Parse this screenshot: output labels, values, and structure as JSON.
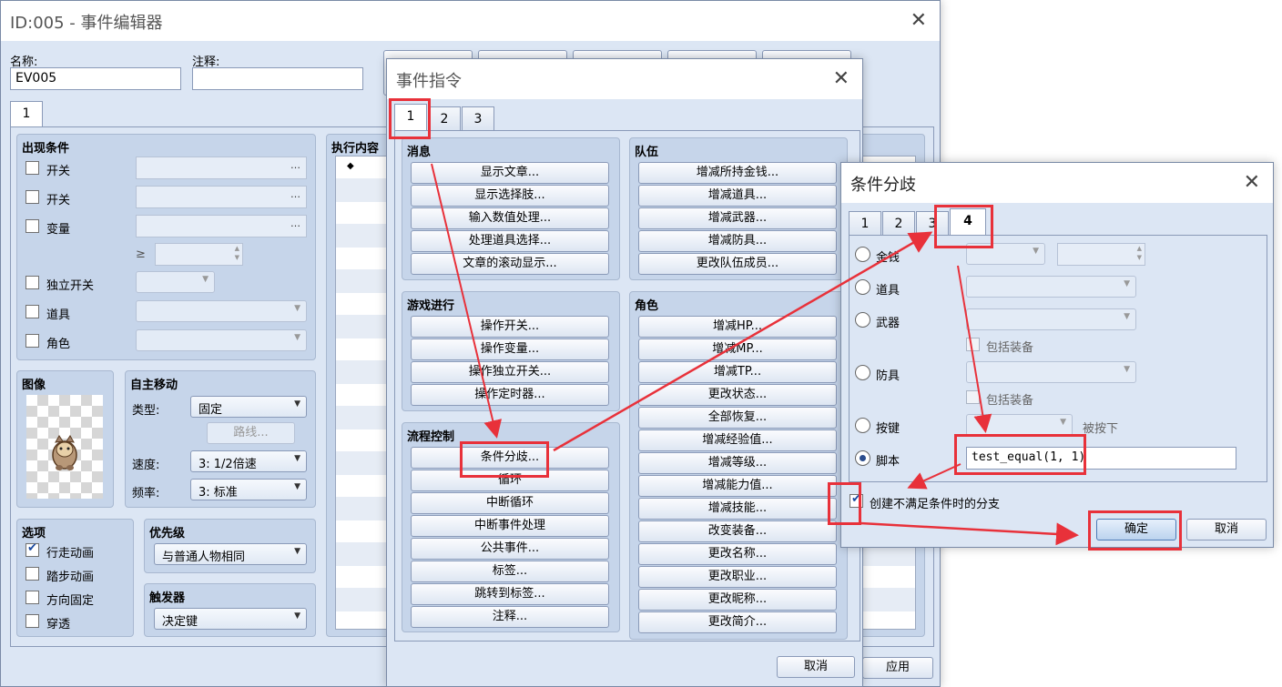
{
  "event_editor": {
    "title": "ID:005 - 事件编辑器",
    "name_label": "名称:",
    "name_value": "EV005",
    "note_label": "注释:",
    "note_value": "",
    "page_tab": "1",
    "conditions": {
      "title": "出现条件",
      "switch1": "开关",
      "switch2": "开关",
      "variable": "变量",
      "gte": "≥",
      "self_switch": "独立开关",
      "item": "道具",
      "actor": "角色",
      "ellipsis": "…"
    },
    "image": {
      "title": "图像"
    },
    "auto_move": {
      "title": "自主移动",
      "type_label": "类型:",
      "type_value": "固定",
      "route_button": "路线...",
      "speed_label": "速度:",
      "speed_value": "3: 1/2倍速",
      "freq_label": "频率:",
      "freq_value": "3: 标准"
    },
    "options": {
      "title": "选项",
      "walking": "行走动画",
      "stepping": "踏步动画",
      "direction_fix": "方向固定",
      "through": "穿透"
    },
    "priority": {
      "title": "优先级",
      "value": "与普通人物相同"
    },
    "trigger": {
      "title": "触发器",
      "value": "决定键"
    },
    "contents": {
      "title": "执行内容",
      "first_row": "◆"
    },
    "apply_button": "应用"
  },
  "command_dialog": {
    "title": "事件指令",
    "tabs": [
      "1",
      "2",
      "3"
    ],
    "message": {
      "title": "消息",
      "items": [
        "显示文章...",
        "显示选择肢...",
        "输入数值处理...",
        "处理道具选择...",
        "文章的滚动显示..."
      ]
    },
    "game_progress": {
      "title": "游戏进行",
      "items": [
        "操作开关...",
        "操作变量...",
        "操作独立开关...",
        "操作定时器..."
      ]
    },
    "flow_control": {
      "title": "流程控制",
      "items": [
        "条件分歧...",
        "循环",
        "中断循环",
        "中断事件处理",
        "公共事件...",
        "标签...",
        "跳转到标签...",
        "注释..."
      ]
    },
    "party": {
      "title": "队伍",
      "items": [
        "增减所持金钱...",
        "增减道具...",
        "增减武器...",
        "增减防具...",
        "更改队伍成员..."
      ]
    },
    "actor": {
      "title": "角色",
      "items": [
        "增减HP...",
        "增减MP...",
        "增减TP...",
        "更改状态...",
        "全部恢复...",
        "增减经验值...",
        "增减等级...",
        "增减能力值...",
        "增减技能...",
        "改变装备...",
        "更改名称...",
        "更改职业...",
        "更改昵称...",
        "更改简介..."
      ]
    },
    "cancel_button": "取消"
  },
  "branch_dialog": {
    "title": "条件分歧",
    "tabs": [
      "1",
      "2",
      "3",
      "4"
    ],
    "gold": "金钱",
    "item": "道具",
    "weapon": "武器",
    "include_equip1": "包括装备",
    "armor": "防具",
    "include_equip2": "包括装备",
    "button": "按键",
    "pressed": "被按下",
    "script": "脚本",
    "script_value": "test_equal(1, 1)",
    "else_branch": "创建不满足条件时的分支",
    "ok_button": "确定",
    "cancel_button": "取消"
  },
  "colors": {
    "annotation": "#e8313a",
    "window_bg": "#dce6f4",
    "group_bg": "#c6d5ea"
  },
  "icons": {
    "close": "close-icon",
    "dropdown": "chevron-down-icon",
    "ellipsis": "ellipsis-icon",
    "character": "sprite-image"
  }
}
